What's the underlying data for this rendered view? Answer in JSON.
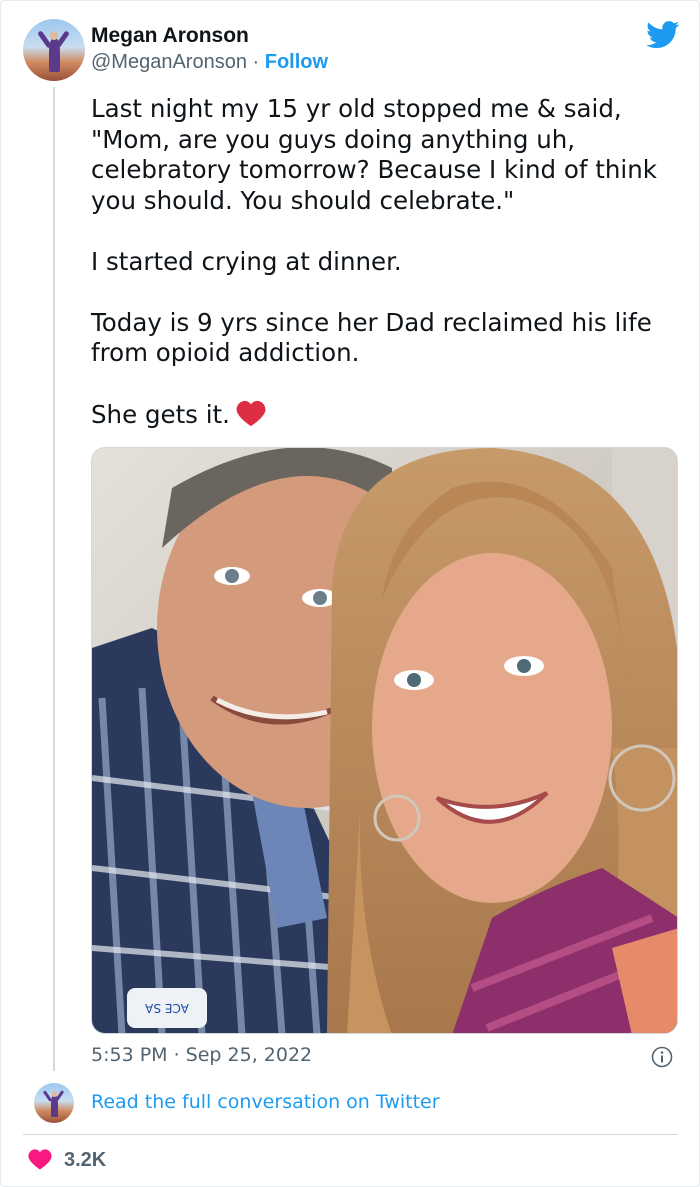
{
  "author": {
    "name": "Megan Aronson",
    "handle": "@MeganAronson",
    "separator": "·",
    "follow_label": "Follow"
  },
  "tweet": {
    "paragraphs": [
      "Last night my 15 yr old stopped me & said, \"Mom, are you guys doing anything uh, celebratory tomorrow? Because I kind of think you should. You should celebrate.\"",
      "I started crying at dinner.",
      "Today is 9 yrs since her Dad reclaimed his life from opioid addiction.",
      "She gets it."
    ],
    "emoji": "red-heart",
    "timestamp": "5:53 PM · Sep 25, 2022"
  },
  "photo": {
    "description_icon": "selfie-photo",
    "badge_text": "ACE SA"
  },
  "footer": {
    "read_link": "Read the full conversation on Twitter",
    "like_count": "3.2K"
  },
  "colors": {
    "accent": "#1d9bf0",
    "like": "#f91880",
    "text": "#0f1419",
    "secondary": "#536471"
  }
}
